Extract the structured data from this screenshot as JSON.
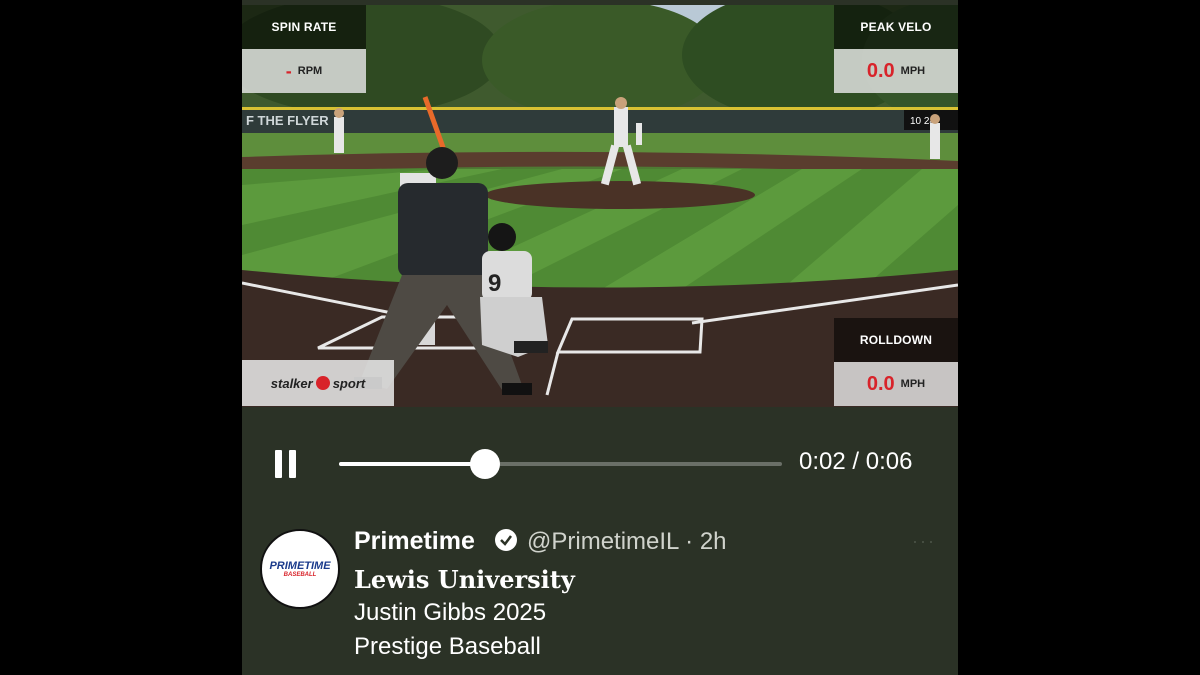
{
  "overlays": {
    "spin_rate": {
      "title": "SPIN RATE",
      "value": "-",
      "unit": "RPM"
    },
    "peak_velo": {
      "title": "PEAK VELO",
      "value": "0.0",
      "unit": "MPH"
    },
    "rolldown": {
      "title": "ROLLDOWN",
      "value": "0.0",
      "unit": "MPH"
    },
    "stalker_logo": {
      "left": "stalker",
      "right": "sport"
    }
  },
  "scene": {
    "banner_text": "F THE FLYER",
    "scoreboard": "10  24",
    "catcher_number": "9"
  },
  "player": {
    "progress": 0.33,
    "current_time": "0:02",
    "duration": "0:06",
    "time_display": "0:02 / 0:06"
  },
  "tweet": {
    "avatar_brand": "PRIMETIME",
    "avatar_sub": "BASEBALL",
    "display_name": "Primetime",
    "handle_time": "@PrimetimeIL · 2h",
    "more": "···",
    "lines": [
      "Lewis University",
      "Justin Gibbs 2025",
      "Prestige Baseball"
    ]
  },
  "colors": {
    "accent_red": "#d8232a",
    "panel_bg": "#2b3226"
  }
}
